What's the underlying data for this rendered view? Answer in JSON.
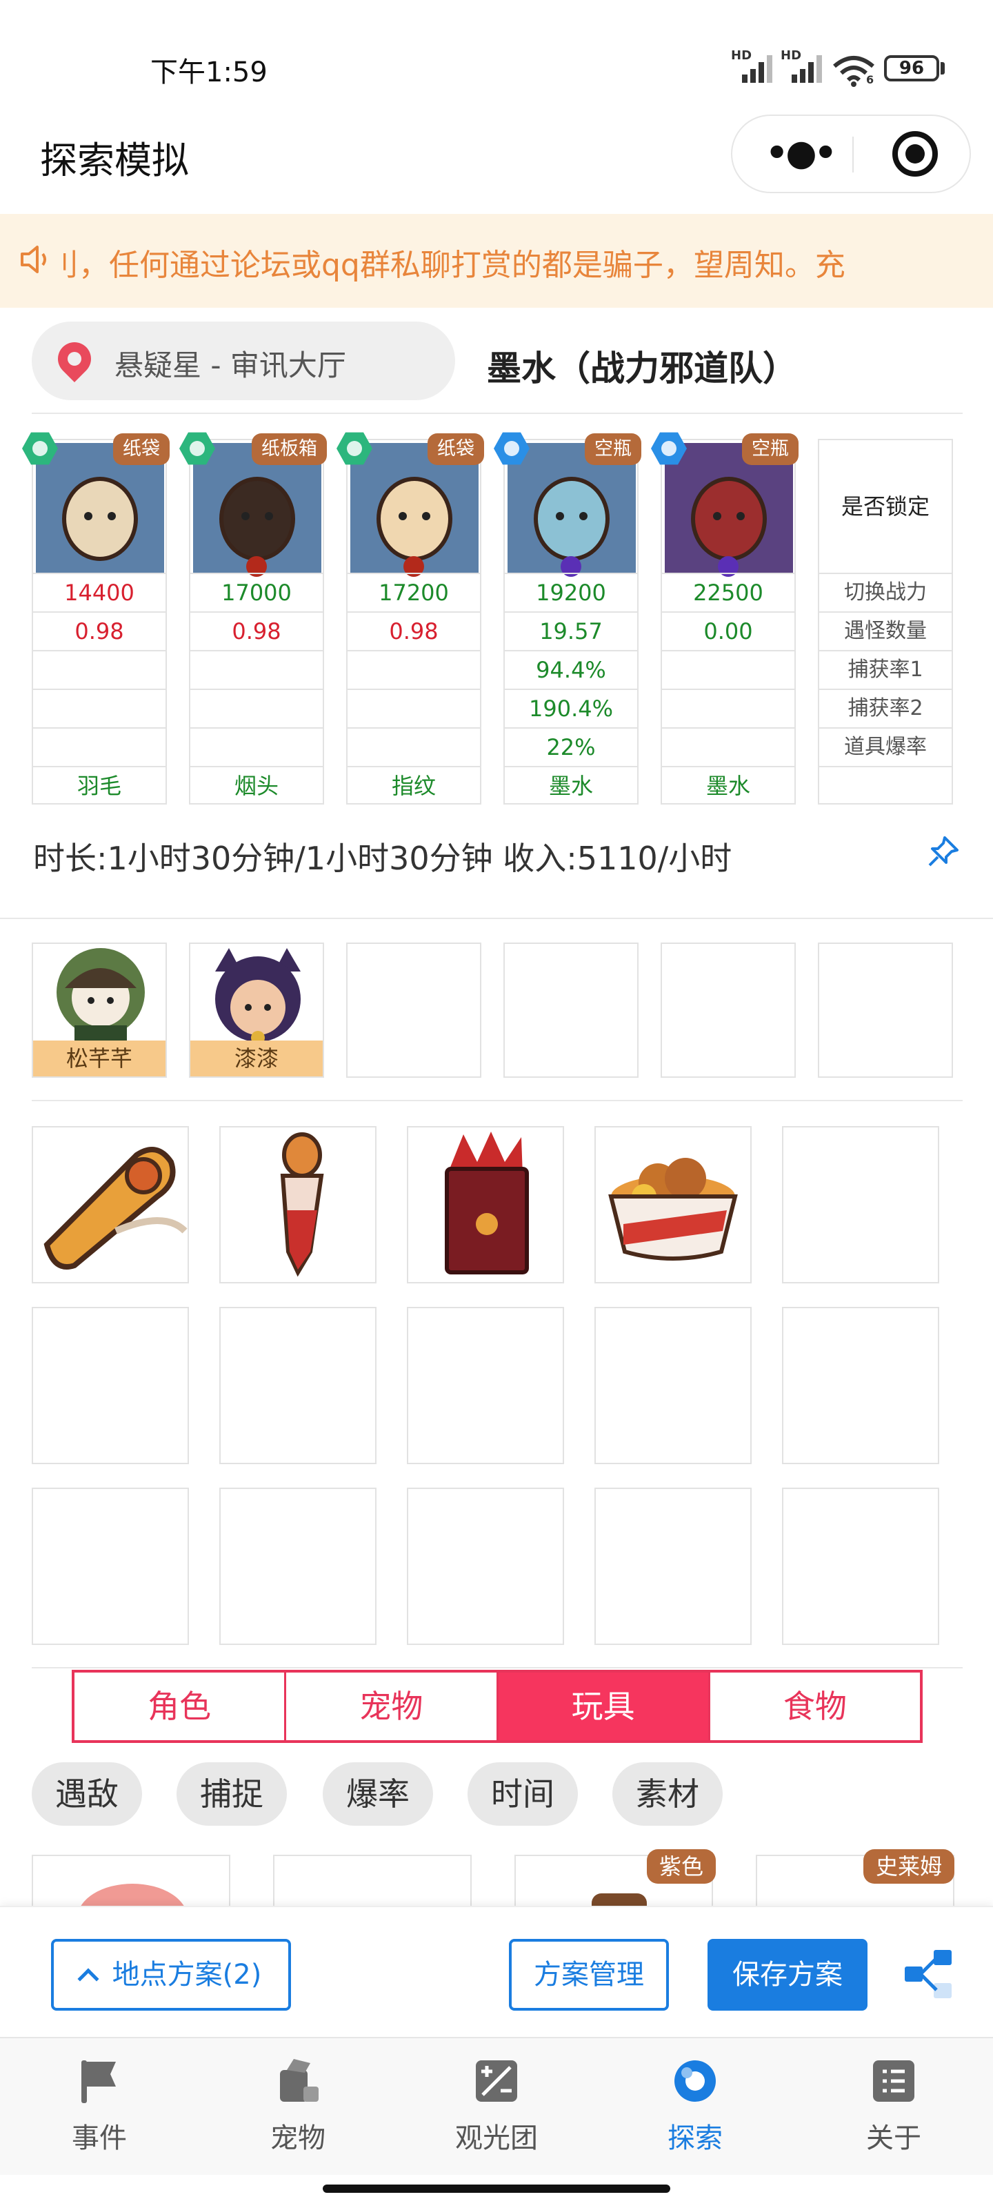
{
  "status_bar": {
    "time": "下午1:59",
    "network_a": "HD",
    "network_b": "HD",
    "wifi_badge": "6",
    "battery": "96"
  },
  "nav": {
    "title": "探索模拟",
    "more_icon": "more-dots-icon",
    "close_icon": "target-circle-icon"
  },
  "notice": {
    "text": "刂，任何通过论坛或qq群私聊打赏的都是骗子，望周知。充",
    "icon": "speaker-icon"
  },
  "location": {
    "place": "悬疑星 - 审讯大厅",
    "team": "墨水（战力邪道队）"
  },
  "pets": [
    {
      "tag": "纸袋",
      "badge_color": "#2cb67d",
      "power": "14400",
      "rate": "0.98",
      "capture1": "",
      "capture2": "",
      "drop": "",
      "item": "羽毛",
      "body": "#e9d7b8",
      "bg": "#5c80a8",
      "elem": ""
    },
    {
      "tag": "纸板箱",
      "badge_color": "#2cb67d",
      "power": "17000",
      "rate": "0.98",
      "capture1": "",
      "capture2": "",
      "drop": "",
      "item": "烟头",
      "body": "#3b2a22",
      "bg": "#5c80a8",
      "elem": "#b3291b"
    },
    {
      "tag": "纸袋",
      "badge_color": "#2cb67d",
      "power": "17200",
      "rate": "0.98",
      "capture1": "",
      "capture2": "",
      "drop": "",
      "item": "指纹",
      "body": "#f0d7b0",
      "bg": "#5c80a8",
      "elem": "#b3291b"
    },
    {
      "tag": "空瓶",
      "badge_color": "#2a8fe6",
      "power": "19200",
      "rate": "19.57",
      "capture1": "94.4%",
      "capture2": "190.4%",
      "drop": "22%",
      "item": "墨水",
      "body": "#8cc1d4",
      "bg": "#5c80a8",
      "elem": "#5a2fb5"
    },
    {
      "tag": "空瓶",
      "badge_color": "#2a8fe6",
      "power": "22500",
      "rate": "0.00",
      "capture1": "",
      "capture2": "",
      "drop": "",
      "item": "墨水",
      "body": "#9c2e2e",
      "bg": "#5a4280",
      "elem": "#5a2fb5"
    }
  ],
  "labels": {
    "lock": "是否锁定",
    "power": "切换战力",
    "encounter": "遇怪数量",
    "capture1": "捕获率1",
    "capture2": "捕获率2",
    "drop": "道具爆率"
  },
  "summary": {
    "text": "时长:1小时30分钟/1小时30分钟 收入:5110/小时",
    "pin_icon": "pin-icon"
  },
  "companions": [
    {
      "name": "松芊芊"
    },
    {
      "name": "漆漆"
    }
  ],
  "items": [
    {
      "name": "whistle-item",
      "color": "#e07a2a"
    },
    {
      "name": "dropper-item",
      "color": "#c9302c"
    },
    {
      "name": "box-item",
      "color": "#8a1e24"
    },
    {
      "name": "food-bowl-item",
      "color": "#e89a3c"
    }
  ],
  "category_tabs": [
    "角色",
    "宠物",
    "玩具",
    "食物"
  ],
  "active_tab": "玩具",
  "filter_chips": [
    "遇敌",
    "捕捉",
    "爆率",
    "时间",
    "素材"
  ],
  "peek_tags": [
    "紫色",
    "史莱姆"
  ],
  "actions": {
    "location_plans": "地点方案(2)",
    "manage": "方案管理",
    "save": "保存方案",
    "share_icon": "share-icon"
  },
  "tabbar": [
    {
      "label": "事件",
      "icon": "flag-icon"
    },
    {
      "label": "宠物",
      "icon": "pet-icon"
    },
    {
      "label": "观光团",
      "icon": "tour-icon"
    },
    {
      "label": "探索",
      "icon": "explore-icon"
    },
    {
      "label": "关于",
      "icon": "about-icon"
    }
  ],
  "colors": {
    "accent": "#1a7de0",
    "tab_active": "#f6355e",
    "notice_text": "#e8853b",
    "notice_bg": "#fdf3e3"
  }
}
